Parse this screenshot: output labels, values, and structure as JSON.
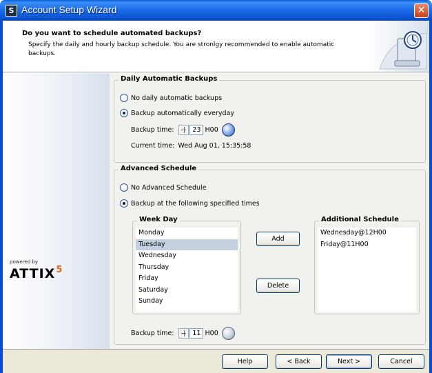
{
  "window": {
    "title": "Account Setup Wizard",
    "app_icon": "S"
  },
  "header": {
    "title": "Do you want to schedule automated backups?",
    "subtitle": "Specify the daily and hourly backup schedule. You are stronlgy recommended to enable automatic backups."
  },
  "sidebar": {
    "powered_by": "powered by",
    "logo_text": "ATTIX",
    "logo_sup": "5",
    "logo_accent": "#e06a10"
  },
  "daily": {
    "legend": "Daily Automatic Backups",
    "option_none": "No daily automatic backups",
    "option_everyday": "Backup automatically everyday",
    "selected": "everyday",
    "backup_time_label": "Backup time:",
    "hour": "23",
    "hour_suffix": "H00",
    "current_time_label": "Current time:",
    "current_time_value": "Wed Aug 01, 15:35:58"
  },
  "advanced": {
    "legend": "Advanced Schedule",
    "option_none": "No Advanced Schedule",
    "option_specified": "Backup at the following specified times",
    "selected": "specified",
    "weekday_legend": "Week Day",
    "weekdays": [
      "Monday",
      "Tuesday",
      "Wednesday",
      "Thursday",
      "Friday",
      "Saturday",
      "Sunday"
    ],
    "selected_weekday": "Tuesday",
    "add_label": "Add",
    "delete_label": "Delete",
    "additional_legend": "Additional Schedule",
    "additional": [
      "Wednesday@12H00",
      "Friday@11H00"
    ],
    "backup_time_label": "Backup time:",
    "hour": "11",
    "hour_suffix": "H00"
  },
  "footer": {
    "help": "Help",
    "back": "< Back",
    "next": "Next >",
    "cancel": "Cancel"
  },
  "colors": {
    "titlebar": "#0c55d4",
    "close": "#c8401a",
    "selection": "#c4d0df"
  }
}
